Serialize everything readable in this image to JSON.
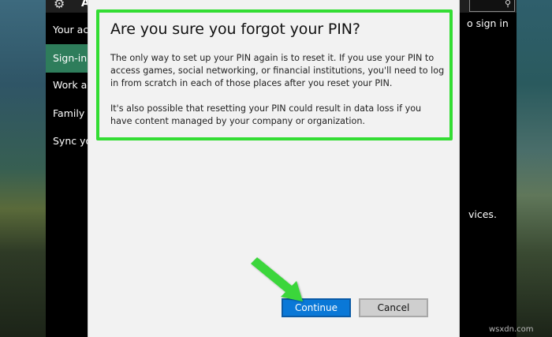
{
  "window": {
    "title": "Ac",
    "nav": [
      {
        "label": "Your acco",
        "active": false
      },
      {
        "label": "Sign-in o",
        "active": true
      },
      {
        "label": "Work acc",
        "active": false
      },
      {
        "label": "Family &",
        "active": false
      },
      {
        "label": "Sync your",
        "active": false
      }
    ],
    "right_texts": [
      "o sign in",
      "vices."
    ]
  },
  "dialog": {
    "title": "Are you sure you forgot your PIN?",
    "paragraph1": "The only way to set up your PIN again is to reset it. If you use your PIN to access games, social networking, or financial institutions, you'll need to log in from scratch in each of those places after you reset your PIN.",
    "paragraph2": "It's also possible that resetting your PIN could result in data loss if you have content managed by your company or organization.",
    "continue_label": "Continue",
    "cancel_label": "Cancel"
  },
  "colors": {
    "highlight": "#33dd33",
    "accent": "#0a78d7",
    "nav_active": "#2e7d5b"
  },
  "watermark": "wsxdn.com"
}
